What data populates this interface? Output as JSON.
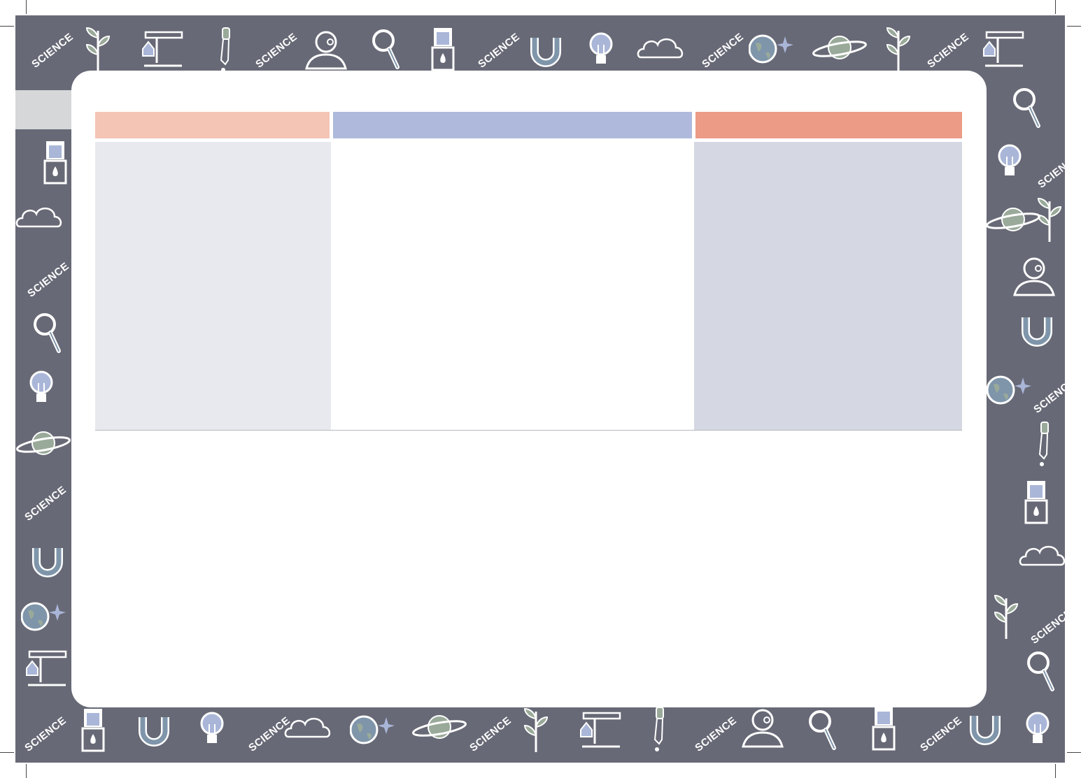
{
  "pattern": {
    "word": "SCIENCE",
    "band_color": "#676976",
    "icon_names": [
      "plant-icon",
      "microscope-icon",
      "dropper-icon",
      "scientist-icon",
      "magnifier-icon",
      "beaker-burner-icon",
      "magnet-icon",
      "lightbulb-icon",
      "cloud-icon",
      "globe-icon",
      "planet-icon"
    ]
  },
  "table": {
    "columns": [
      {
        "header": "",
        "header_color": "#f4c4b5",
        "body_color": "#e8e9ee"
      },
      {
        "header": "",
        "header_color": "#aeb9dc",
        "body_color": "#ffffff"
      },
      {
        "header": "",
        "header_color": "#eb9b86",
        "body_color": "#d5d8e2"
      }
    ]
  }
}
